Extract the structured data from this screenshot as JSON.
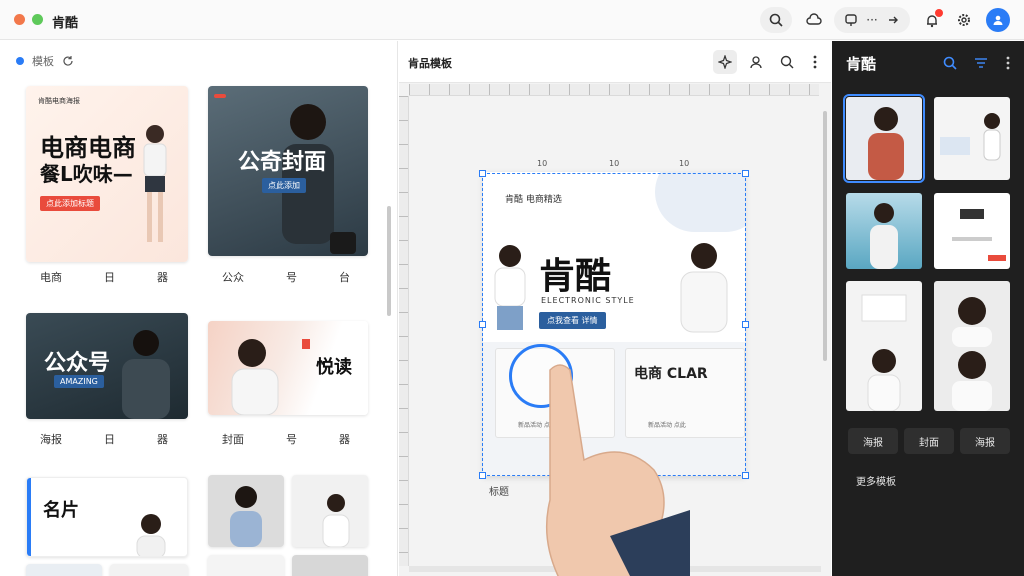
{
  "topbar": {
    "app_title": "肯酷",
    "group_label": "···"
  },
  "left_panel": {
    "header_label": "模板",
    "cards": [
      {
        "title": "电商电商",
        "subtitle": "餐L吹味—",
        "chip": "点此添加标题",
        "header": "肯酷电商海报"
      },
      {
        "title": "公奇封面",
        "chip": "点此添加"
      },
      {
        "title": "公众号",
        "subtitle": "AMAZING"
      },
      {
        "title": "悦读",
        "subtitle": ""
      },
      {
        "title": "名片",
        "subtitle": ""
      }
    ],
    "row1_labels": [
      "电商",
      "日",
      "器"
    ],
    "row1b_labels": [
      "公众",
      "号",
      "台"
    ],
    "row2_labels": [
      "海报",
      "日",
      "器"
    ],
    "row2b_labels": [
      "封面",
      "号",
      "器"
    ]
  },
  "editor": {
    "title": "肯品模板",
    "doc_header": "肯酷 电商精选",
    "doc_title": "肯酷",
    "doc_subtitle": "ELECTRONIC STYLE",
    "doc_chip": "点我查看 详情",
    "card_left_title": "",
    "card_right_title": "电商 CLAR",
    "card_left_caption": "新品活动 点此上新",
    "card_right_caption": "新品活动 点此",
    "caption": "标题",
    "ruler_tags": [
      "10",
      "10",
      "10"
    ]
  },
  "right_panel": {
    "title": "肯酷",
    "buttons": [
      "海报",
      "封面",
      "海报"
    ],
    "footer": "更多模板"
  },
  "colors": {
    "accent": "#2a7cf6",
    "dark_panel": "#1f1f1f",
    "chip_red": "#e94b3c",
    "chip_blue": "#2b5f9e"
  }
}
